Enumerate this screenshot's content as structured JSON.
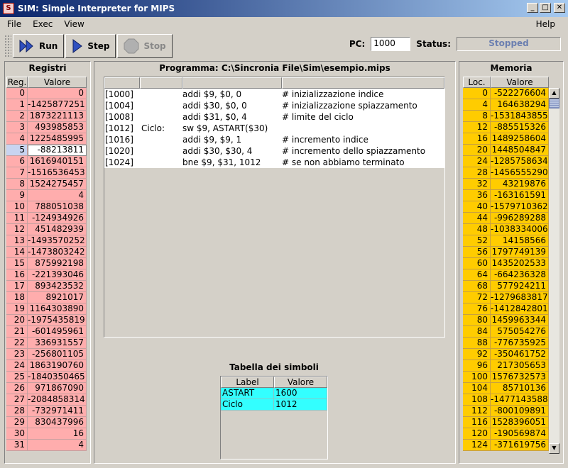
{
  "window": {
    "title": "SIM: Simple Interpreter for MIPS"
  },
  "menu": {
    "file": "File",
    "exec": "Exec",
    "view": "View",
    "help": "Help"
  },
  "toolbar": {
    "run": "Run",
    "step": "Step",
    "stop": "Stop"
  },
  "pc": {
    "label": "PC:",
    "value": "1000"
  },
  "status": {
    "label": "Status:",
    "value": "Stopped"
  },
  "registers": {
    "title": "Registri",
    "col_reg": "Reg.",
    "col_val": "Valore",
    "rows": [
      [
        "0",
        "0"
      ],
      [
        "1",
        "-1425877251"
      ],
      [
        "2",
        "1873221113"
      ],
      [
        "3",
        "493985853"
      ],
      [
        "4",
        "1225485995"
      ],
      [
        "5",
        "-88213811"
      ],
      [
        "6",
        "1616940151"
      ],
      [
        "7",
        "-1516536453"
      ],
      [
        "8",
        "1524275457"
      ],
      [
        "9",
        "4"
      ],
      [
        "10",
        "788051038"
      ],
      [
        "11",
        "-124934926"
      ],
      [
        "12",
        "451482939"
      ],
      [
        "13",
        "-1493570252"
      ],
      [
        "14",
        "-1473803242"
      ],
      [
        "15",
        "875992198"
      ],
      [
        "16",
        "-221393046"
      ],
      [
        "17",
        "893423532"
      ],
      [
        "18",
        "8921017"
      ],
      [
        "19",
        "1164303890"
      ],
      [
        "20",
        "-1975435819"
      ],
      [
        "21",
        "-601495961"
      ],
      [
        "22",
        "336931557"
      ],
      [
        "23",
        "-256801105"
      ],
      [
        "24",
        "1863190760"
      ],
      [
        "25",
        "-1840350465"
      ],
      [
        "26",
        "971867090"
      ],
      [
        "27",
        "-2084858314"
      ],
      [
        "28",
        "-732971411"
      ],
      [
        "29",
        "830437996"
      ],
      [
        "30",
        "16"
      ],
      [
        "31",
        "4"
      ]
    ]
  },
  "program": {
    "title": "Programma: C:\\Sincronia File\\Sim\\esempio.mips",
    "rows": [
      [
        "[1000]",
        "",
        "addi $9, $0, 0",
        "#  inizializzazione indice"
      ],
      [
        "[1004]",
        "",
        "addi $30, $0, 0",
        "#  inizializzazione spiazzamento"
      ],
      [
        "[1008]",
        "",
        "addi $31, $0, 4",
        "#  limite del ciclo"
      ],
      [
        "[1012]",
        "Ciclo:",
        "sw $9, ASTART($30)",
        ""
      ],
      [
        "[1016]",
        "",
        "addi $9, $9, 1",
        "#  incremento indice"
      ],
      [
        "[1020]",
        "",
        "addi $30, $30, 4",
        "# incremento dello spiazzamento"
      ],
      [
        "[1024]",
        "",
        "bne $9, $31, 1012",
        "# se non abbiamo terminato"
      ]
    ]
  },
  "symbols": {
    "title": "Tabella dei simboli",
    "col_label": "Label",
    "col_val": "Valore",
    "rows": [
      [
        "ASTART",
        "1600"
      ],
      [
        "Ciclo",
        "1012"
      ]
    ]
  },
  "memory": {
    "title": "Memoria",
    "col_loc": "Loc.",
    "col_val": "Valore",
    "rows": [
      [
        "0",
        "-522276604"
      ],
      [
        "4",
        "164638294"
      ],
      [
        "8",
        "-1531843855"
      ],
      [
        "12",
        "-885515326"
      ],
      [
        "16",
        "1489258604"
      ],
      [
        "20",
        "1448504847"
      ],
      [
        "24",
        "-1285758634"
      ],
      [
        "28",
        "-1456555290"
      ],
      [
        "32",
        "43219876"
      ],
      [
        "36",
        "-163161591"
      ],
      [
        "40",
        "-1579710362"
      ],
      [
        "44",
        "-996289288"
      ],
      [
        "48",
        "-1038334006"
      ],
      [
        "52",
        "14158566"
      ],
      [
        "56",
        "1797749139"
      ],
      [
        "60",
        "1435202533"
      ],
      [
        "64",
        "-664236328"
      ],
      [
        "68",
        "577924211"
      ],
      [
        "72",
        "-1279683817"
      ],
      [
        "76",
        "-1412842801"
      ],
      [
        "80",
        "1459963344"
      ],
      [
        "84",
        "575054276"
      ],
      [
        "88",
        "-776735925"
      ],
      [
        "92",
        "-350461752"
      ],
      [
        "96",
        "217305653"
      ],
      [
        "100",
        "1576732573"
      ],
      [
        "104",
        "85710136"
      ],
      [
        "108",
        "-1477143588"
      ],
      [
        "112",
        "-800109891"
      ],
      [
        "116",
        "1528396051"
      ],
      [
        "120",
        "-190569874"
      ],
      [
        "124",
        "-371619756"
      ]
    ]
  }
}
